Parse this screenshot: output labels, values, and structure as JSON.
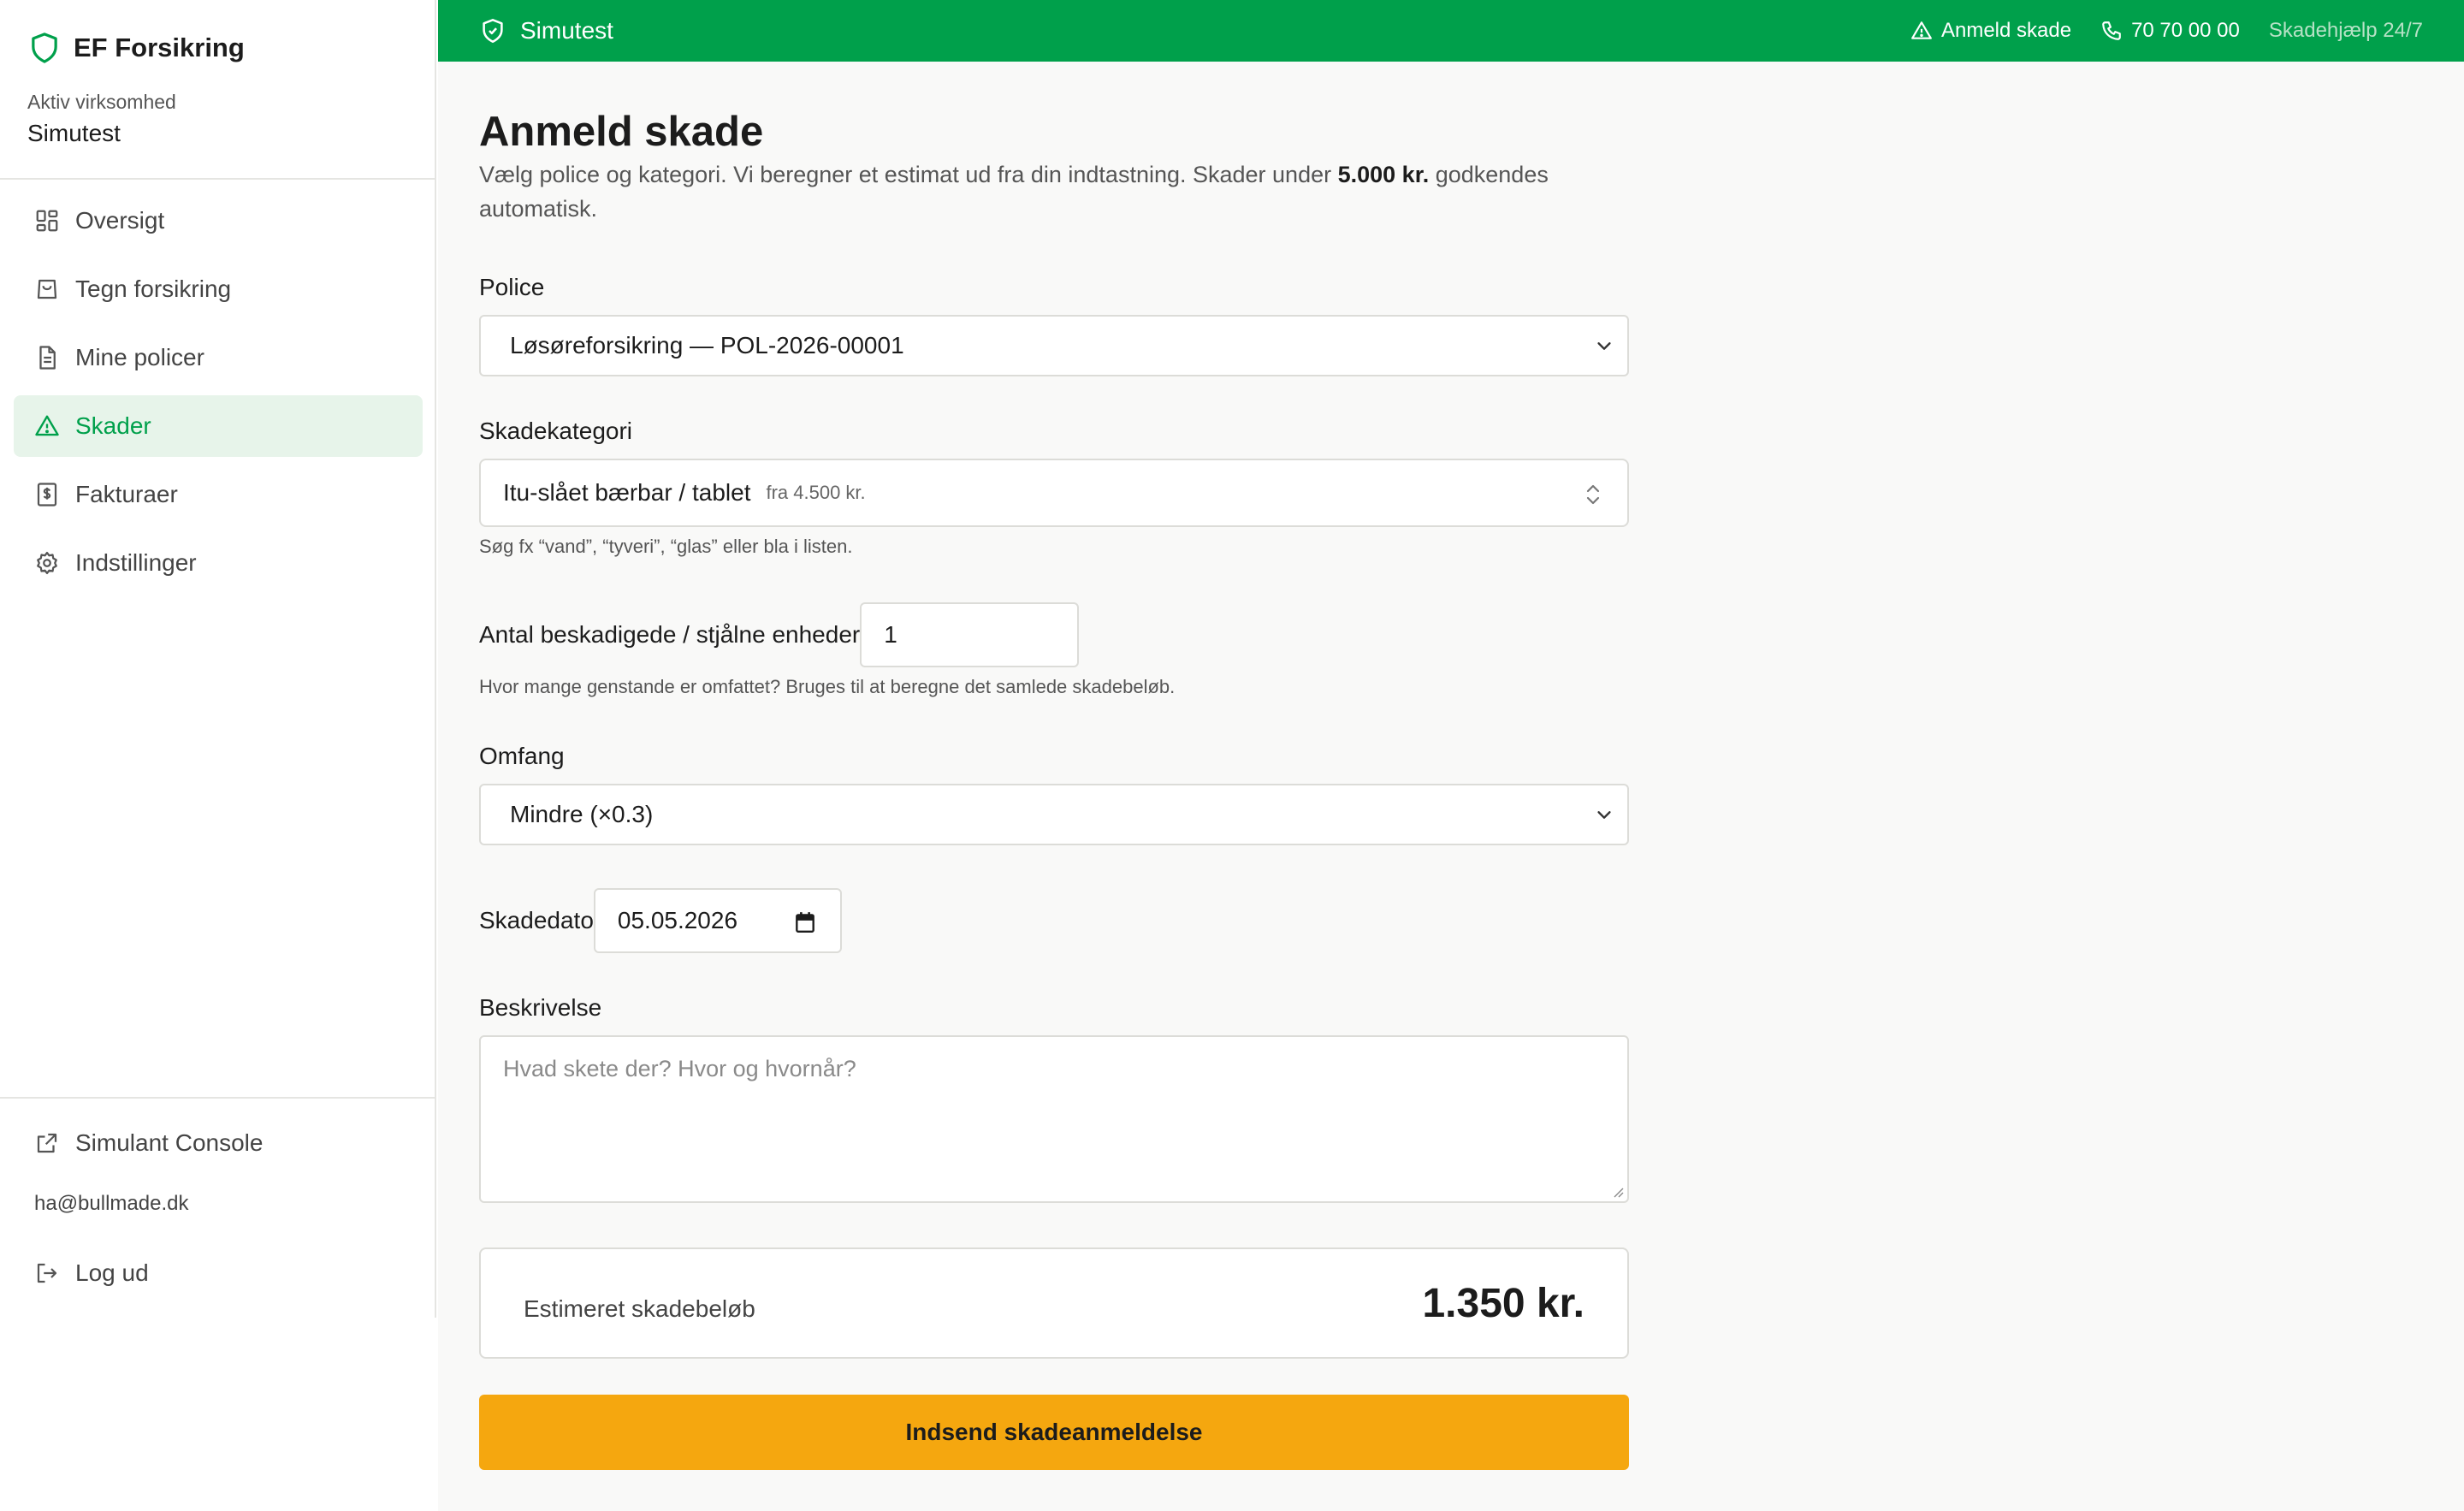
{
  "brand": {
    "name": "EF Forsikring"
  },
  "company": {
    "label": "Aktiv virksomhed",
    "name": "Simutest"
  },
  "nav": {
    "items": [
      {
        "label": "Oversigt",
        "icon": "dashboard-grid-icon"
      },
      {
        "label": "Tegn forsikring",
        "icon": "shopping-bag-icon"
      },
      {
        "label": "Mine policer",
        "icon": "document-icon"
      },
      {
        "label": "Skader",
        "icon": "warning-triangle-icon",
        "active": true
      },
      {
        "label": "Fakturaer",
        "icon": "invoice-dollar-icon"
      },
      {
        "label": "Indstillinger",
        "icon": "gear-icon"
      }
    ]
  },
  "bottom_nav": {
    "console_label": "Simulant Console",
    "email": "ha@bullmade.dk",
    "logout_label": "Log ud"
  },
  "topbar": {
    "company": "Simutest",
    "report_label": "Anmeld skade",
    "phone": "70 70 00 00",
    "help_label": "Skadehjælp 24/7"
  },
  "page": {
    "title": "Anmeld skade",
    "desc_prefix": "Vælg police og kategori. Vi beregner et estimat ud fra din indtastning. Skader under ",
    "desc_bold": "5.000 kr.",
    "desc_suffix": " godkendes automatisk."
  },
  "form": {
    "police_label": "Police",
    "police_value": "Løsøreforsikring — POL-2026-00001",
    "category_label": "Skadekategori",
    "category_value": "Itu-slået bærbar / tablet",
    "category_price": "fra 4.500 kr.",
    "category_help": "Søg fx “vand”, “tyveri”, “glas” eller bla i listen.",
    "units_label": "Antal beskadigede / stjålne enheder",
    "units_value": "1",
    "units_help": "Hvor mange genstande er omfattet? Bruges til at beregne det samlede skadebeløb.",
    "scope_label": "Omfang",
    "scope_value": "Mindre (×0.3)",
    "date_label": "Skadedato",
    "date_value": "05.05.2026",
    "desc_label": "Beskrivelse",
    "desc_placeholder": "Hvad skete der? Hvor og hvornår?",
    "estimate_label": "Estimeret skadebeløb",
    "estimate_value": "1.350 kr.",
    "submit_label": "Indsend skadeanmeldelse"
  },
  "colors": {
    "brand_green": "#00a04b",
    "active_bg": "#e7f4ea",
    "submit_orange": "#f5a70f"
  }
}
